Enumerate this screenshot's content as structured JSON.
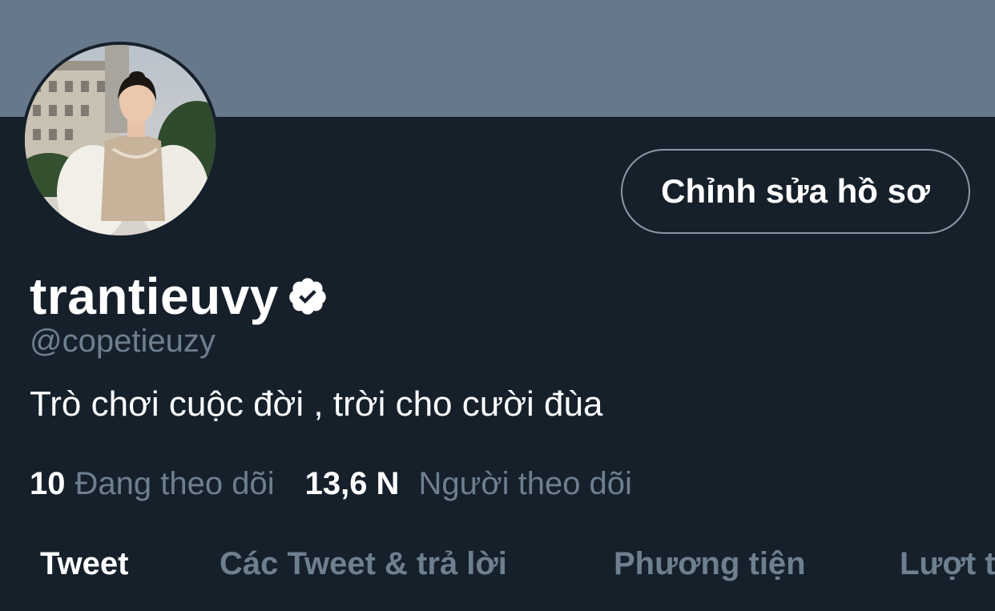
{
  "profile": {
    "display_name": "trantieuvy",
    "handle": "@copetieuzy",
    "bio": "Trò chơi cuộc đời , trời cho cười đùa",
    "verified_icon": "verified-badge-icon",
    "edit_button_label": "Chỉnh sửa hồ sơ"
  },
  "stats": {
    "following_count": "10",
    "following_label": "Đang theo dõi",
    "followers_count": "13,6 N",
    "followers_label": "Người theo dõi"
  },
  "tabs": [
    {
      "label": "Tweet",
      "active": true
    },
    {
      "label": "Các Tweet & trả lời",
      "active": false
    },
    {
      "label": "Phương tiện",
      "active": false
    },
    {
      "label": "Lượt thích",
      "active": false
    }
  ],
  "colors": {
    "background": "#15202b",
    "banner": "#66788a",
    "muted_text": "#6e7f8f",
    "button_border": "#8b98a5"
  }
}
